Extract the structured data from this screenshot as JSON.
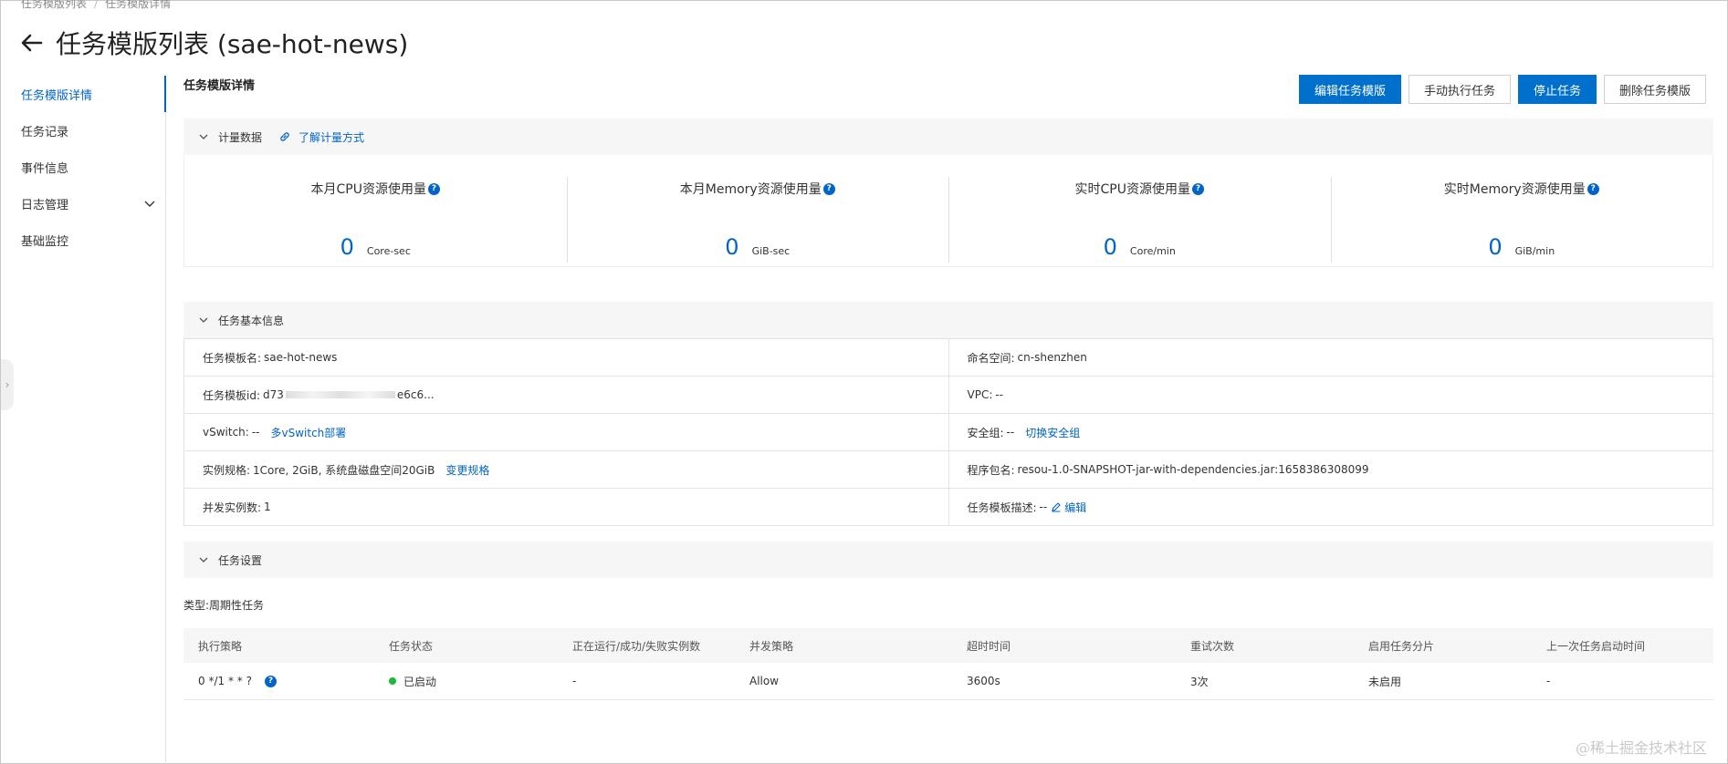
{
  "breadcrumb": [
    "任务模版列表",
    "任务模版详情"
  ],
  "page_title": "任务模版列表 (sae-hot-news)",
  "sidebar": {
    "items": [
      {
        "label": "任务模版详情",
        "active": true
      },
      {
        "label": "任务记录"
      },
      {
        "label": "事件信息"
      },
      {
        "label": "日志管理",
        "expandable": true
      },
      {
        "label": "基础监控"
      }
    ]
  },
  "section_title": "任务模版详情",
  "actions": {
    "edit": "编辑任务模版",
    "run": "手动执行任务",
    "stop": "停止任务",
    "delete": "删除任务模版"
  },
  "metering": {
    "title": "计量数据",
    "link": "了解计量方式",
    "metrics": [
      {
        "label": "本月CPU资源使用量",
        "value": "0",
        "unit": "Core-sec"
      },
      {
        "label": "本月Memory资源使用量",
        "value": "0",
        "unit": "GiB-sec"
      },
      {
        "label": "实时CPU资源使用量",
        "value": "0",
        "unit": "Core/min"
      },
      {
        "label": "实时Memory资源使用量",
        "value": "0",
        "unit": "GiB/min"
      }
    ]
  },
  "basic_info": {
    "title": "任务基本信息",
    "template_name_label": "任务模板名:",
    "template_name": "sae-hot-news",
    "namespace_label": "命名空间:",
    "namespace": "cn-shenzhen",
    "template_id_label": "任务模板id:",
    "template_id_prefix": "d73",
    "template_id_suffix": "e6c6...",
    "vpc_label": "VPC:",
    "vpc": "--",
    "vswitch_label": "vSwitch:",
    "vswitch": "--",
    "vswitch_link": "多vSwitch部署",
    "security_group_label": "安全组:",
    "security_group": "--",
    "security_group_link": "切换安全组",
    "spec_label": "实例规格:",
    "spec": "1Core, 2GiB, 系统盘磁盘空间20GiB",
    "spec_link": "变更规格",
    "package_label": "程序包名:",
    "package": "resou-1.0-SNAPSHOT-jar-with-dependencies.jar:1658386308099",
    "concurrency_label": "并发实例数:",
    "concurrency": "1",
    "desc_label": "任务模板描述:",
    "desc": "--",
    "desc_link": "编辑"
  },
  "task_settings": {
    "title": "任务设置",
    "type_label": "类型:",
    "type_value": "周期性任务",
    "columns": [
      "执行策略",
      "任务状态",
      "正在运行/成功/失败实例数",
      "并发策略",
      "超时时间",
      "重试次数",
      "启用任务分片",
      "上一次任务启动时间"
    ],
    "row": {
      "strategy": "0 */1 * * ?",
      "status": "已启动",
      "status_color": "#1bb934",
      "instances": "-",
      "concurrency_policy": "Allow",
      "timeout": "3600s",
      "retries": "3次",
      "sharding": "未启用",
      "last_start": "-"
    }
  },
  "watermark": "@稀土掘金技术社区",
  "colors": {
    "accent": "#0064c8",
    "primary_button": "#0070cc"
  }
}
